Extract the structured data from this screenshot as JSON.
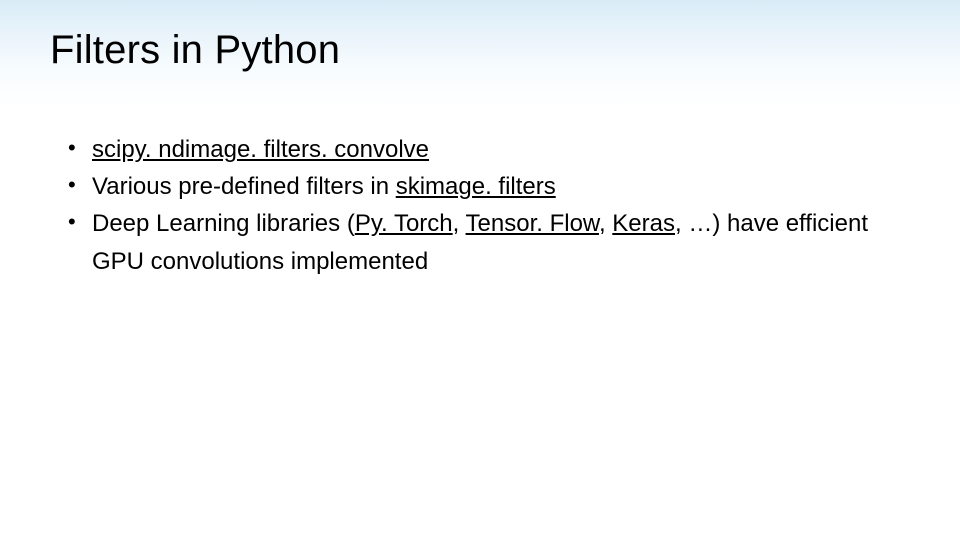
{
  "title": "Filters in Python",
  "bullets": {
    "b1": {
      "link": "scipy. ndimage. filters. convolve"
    },
    "b2": {
      "pre": "Various pre-defined filters in ",
      "link": "skimage. filters"
    },
    "b3": {
      "t1": "Deep Learning libraries (",
      "l1": "Py. Torch",
      "t2": ", ",
      "l2": "Tensor. Flow",
      "t3": ", ",
      "l3": "Keras",
      "t4": ", …) have efficient GPU convolutions implemented"
    }
  }
}
